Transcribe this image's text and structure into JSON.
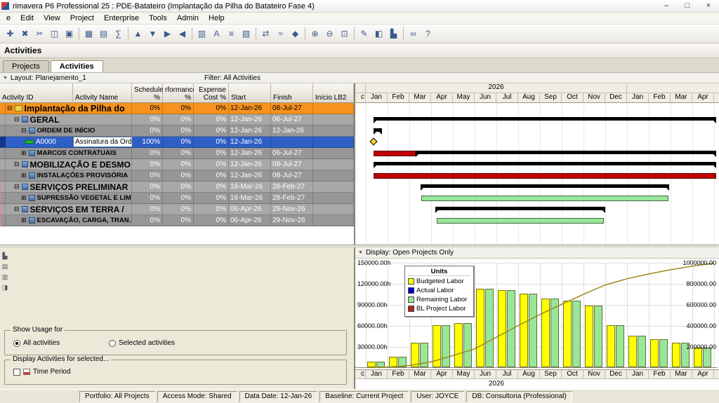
{
  "window": {
    "title": "rimavera P6 Professional 25 : PDE-Batateiro (Implantação da Pilha do Batateiro Fase 4)",
    "minimize": "–",
    "maximize": "□",
    "close": "×"
  },
  "menu": {
    "items": [
      "e",
      "Edit",
      "View",
      "Project",
      "Enterprise",
      "Tools",
      "Admin",
      "Help"
    ]
  },
  "toolbar": {
    "icons": [
      {
        "name": "add-row-icon",
        "glyph": "✚"
      },
      {
        "name": "delete-row-icon",
        "glyph": "✖"
      },
      {
        "name": "cut-icon",
        "glyph": "✂"
      },
      {
        "name": "copy-icon",
        "glyph": "◫"
      },
      {
        "name": "paste-icon",
        "glyph": "▣"
      },
      {
        "sep": true
      },
      {
        "name": "schedule-icon",
        "glyph": "▦"
      },
      {
        "name": "level-resources-icon",
        "glyph": "▤"
      },
      {
        "name": "summarize-icon",
        "glyph": "∑"
      },
      {
        "sep": true
      },
      {
        "name": "move-up-icon",
        "glyph": "▲"
      },
      {
        "name": "move-down-icon",
        "glyph": "▼"
      },
      {
        "name": "indent-icon",
        "glyph": "▶"
      },
      {
        "name": "outdent-icon",
        "glyph": "◀"
      },
      {
        "sep": true
      },
      {
        "name": "columns-icon",
        "glyph": "▥"
      },
      {
        "name": "table-font-icon",
        "glyph": "A"
      },
      {
        "name": "filters-icon",
        "glyph": "≡"
      },
      {
        "name": "group-sort-icon",
        "glyph": "▧"
      },
      {
        "sep": true
      },
      {
        "name": "relationships-icon",
        "glyph": "⇄"
      },
      {
        "name": "progress-line-icon",
        "glyph": "≈"
      },
      {
        "name": "data-date-icon",
        "glyph": "◆"
      },
      {
        "sep": true
      },
      {
        "name": "zoom-in-icon",
        "glyph": "⊕"
      },
      {
        "name": "zoom-out-icon",
        "glyph": "⊖"
      },
      {
        "name": "zoom-fit-icon",
        "glyph": "⊡"
      },
      {
        "sep": true
      },
      {
        "name": "assign-resources-icon",
        "glyph": "✎"
      },
      {
        "name": "activity-details-icon",
        "glyph": "◧"
      },
      {
        "name": "usage-profile-icon",
        "glyph": "▙"
      },
      {
        "sep": true
      },
      {
        "name": "link-icon",
        "glyph": "∞"
      },
      {
        "name": "help-icon",
        "glyph": "?"
      }
    ]
  },
  "view_title": "Activities",
  "tabs": {
    "projects": "Projects",
    "activities": "Activities"
  },
  "layout_bar": {
    "chevron": "▼",
    "layout": "Layout: Planejamento_1",
    "filter": "Filter: All Activities"
  },
  "table": {
    "headers": {
      "id": "Activity ID",
      "name": "Activity Name",
      "schedule": "Schedule\n%",
      "performance": "rformance\n%",
      "expense": "Expense\nCost %",
      "start": "Start",
      "finish": "Finish",
      "inicio": "Início LB2"
    },
    "rows": [
      {
        "expand": "⊟",
        "label": "Implantação da Pilha do",
        "schedule": "0%",
        "performance": "0%",
        "expense": "0%",
        "start": "12-Jan-26",
        "finish": "08-Jul-27",
        "inicio": ""
      },
      {
        "expand": "⊟",
        "label": "GERAL",
        "schedule": "0%",
        "performance": "0%",
        "expense": "0%",
        "start": "12-Jan-26",
        "finish": "06-Jul-27",
        "inicio": ""
      },
      {
        "expand": "⊟",
        "label": "ORDEM DE INÍCIO",
        "schedule": "0%",
        "performance": "0%",
        "expense": "0%",
        "start": "12-Jan-26",
        "finish": "12-Jan-26",
        "inicio": ""
      },
      {
        "id": "A0000",
        "name": "Assinatura da Orde",
        "schedule": "100%",
        "performance": "0%",
        "expense": "0%",
        "start": "12-Jan-26",
        "finish": "",
        "inicio": ""
      },
      {
        "expand": "⊞",
        "label": "MARCOS CONTRATUAIS",
        "schedule": "0%",
        "performance": "0%",
        "expense": "0%",
        "start": "12-Jan-26",
        "finish": "06-Jul-27",
        "inicio": ""
      },
      {
        "expand": "⊟",
        "label": "MOBILIZAÇÃO E DESMO",
        "schedule": "0%",
        "performance": "0%",
        "expense": "0%",
        "start": "12-Jan-26",
        "finish": "08-Jul-27",
        "inicio": ""
      },
      {
        "expand": "⊞",
        "label": "INSTALAÇÕES PROVISÓRIA",
        "schedule": "0%",
        "performance": "0%",
        "expense": "0%",
        "start": "12-Jan-26",
        "finish": "08-Jul-27",
        "inicio": ""
      },
      {
        "expand": "⊟",
        "label": "SERVIÇOS PRELIMINAR",
        "schedule": "0%",
        "performance": "0%",
        "expense": "0%",
        "start": "16-Mar-26",
        "finish": "28-Feb-27",
        "inicio": ""
      },
      {
        "expand": "⊞",
        "label": "SUPRESSÃO VEGETAL E LIM",
        "schedule": "0%",
        "performance": "0%",
        "expense": "0%",
        "start": "16-Mar-26",
        "finish": "28-Feb-27",
        "inicio": ""
      },
      {
        "expand": "⊟",
        "label": "SERVIÇOS EM TERRA /",
        "schedule": "0%",
        "performance": "0%",
        "expense": "0%",
        "start": "06-Apr-26",
        "finish": "29-Nov-26",
        "inicio": ""
      },
      {
        "expand": "⊞",
        "label": "ESCAVAÇÃO, CARGA, TRAN...",
        "schedule": "0%",
        "performance": "0%",
        "expense": "0%",
        "start": "06-Apr-26",
        "finish": "29-Nov-26",
        "inicio": ""
      }
    ]
  },
  "gantt": {
    "cut": "c",
    "year": "2026",
    "months": [
      "Jan",
      "Feb",
      "Mar",
      "Apr",
      "May",
      "Jun",
      "Jul",
      "Aug",
      "Sep",
      "Oct",
      "Nov",
      "Dec",
      "Jan",
      "Feb",
      "Mar",
      "Apr"
    ],
    "rows": [
      [],
      [
        {
          "type": "summary",
          "from": 0.35,
          "to": 16.1
        }
      ],
      [
        {
          "type": "summary",
          "from": 0.35,
          "to": 0.75
        }
      ],
      [
        {
          "type": "milestone",
          "at": 0.35,
          "color": "#F5D327"
        }
      ],
      [
        {
          "type": "bar",
          "from": 0.35,
          "to": 2.3,
          "color": "#C00000"
        },
        {
          "type": "summary",
          "from": 2.3,
          "to": 16.1
        }
      ],
      [
        {
          "type": "summary",
          "from": 0.35,
          "to": 16.1
        }
      ],
      [
        {
          "type": "bar",
          "from": 0.35,
          "to": 16.1,
          "color": "#C00000"
        }
      ],
      [
        {
          "type": "summary",
          "from": 2.5,
          "to": 13.95
        }
      ],
      [
        {
          "type": "bar",
          "from": 2.55,
          "to": 13.9,
          "color": "#98E698"
        }
      ],
      [
        {
          "type": "summary",
          "from": 3.2,
          "to": 11.0
        }
      ],
      [
        {
          "type": "bar",
          "from": 3.25,
          "to": 10.95,
          "color": "#98E698"
        }
      ]
    ]
  },
  "usage_panel": {
    "mini_icons": [
      {
        "name": "profile-settings-icon",
        "glyph": "▙"
      },
      {
        "name": "usage-table-icon",
        "glyph": "▤"
      },
      {
        "name": "histogram-view-icon",
        "glyph": "▥"
      },
      {
        "name": "panel-options-icon",
        "glyph": "◨"
      }
    ],
    "show_usage_for": "Show Usage for",
    "all_activities": "All activities",
    "selected_activities": "Selected activities",
    "display_activities": "Display Activities for selected...",
    "time_period": "Time Period"
  },
  "profile": {
    "chevron": "▼",
    "display": "Display: Open Projects Only",
    "legend_title": "Units",
    "legend": [
      {
        "label": "Budgeted Labor",
        "color": "#FFFF00"
      },
      {
        "label": "Actual Labor",
        "color": "#0000CC"
      },
      {
        "label": "Remaining Labor",
        "color": "#98E698"
      },
      {
        "label": "BL Project Labor",
        "color": "#B22222"
      }
    ],
    "left_axis": [
      "150000.00h",
      "120000.00h",
      "90000.00h",
      "60000.00h",
      "30000.00h"
    ],
    "right_axis": [
      "1000000.00",
      "800000.00",
      "600000.00",
      "400000.00",
      "200000.00"
    ],
    "cut": "c",
    "year": "2026"
  },
  "chart_data": {
    "type": "bar",
    "title": "Resource Usage Profile - Units",
    "categories": [
      "Jan-26",
      "Feb-26",
      "Mar-26",
      "Apr-26",
      "May-26",
      "Jun-26",
      "Jul-26",
      "Aug-26",
      "Sep-26",
      "Oct-26",
      "Nov-26",
      "Dec-26",
      "Jan-27",
      "Feb-27",
      "Mar-27",
      "Apr-27"
    ],
    "series": [
      {
        "name": "Budgeted Labor",
        "color": "#FFFF00",
        "values": [
          8000,
          15000,
          35000,
          60000,
          63000,
          112000,
          110000,
          105000,
          98000,
          95000,
          88000,
          60000,
          45000,
          40000,
          35000,
          28000
        ]
      },
      {
        "name": "Remaining Labor",
        "color": "#98E698",
        "values": [
          8000,
          15000,
          35000,
          60000,
          63000,
          112000,
          110000,
          105000,
          98000,
          95000,
          88000,
          60000,
          45000,
          40000,
          35000,
          28000
        ]
      },
      {
        "name": "Actual Labor",
        "color": "#0000CC",
        "values": [
          0,
          0,
          0,
          0,
          0,
          0,
          0,
          0,
          0,
          0,
          0,
          0,
          0,
          0,
          0,
          0
        ]
      }
    ],
    "cumulative_line": {
      "name": "BL Project Labor (cumulative)",
      "color": "#9C8A1C",
      "values": [
        8000,
        23000,
        58000,
        118000,
        181000,
        293000,
        403000,
        508000,
        606000,
        701000,
        789000,
        849000,
        894000,
        934000,
        969000,
        997000
      ]
    },
    "xlabel": "2026",
    "ylabel": "hours",
    "ylim_left": [
      0,
      150000
    ],
    "ylim_right": [
      0,
      1000000
    ],
    "legend_position": "top-left",
    "grid": true
  },
  "colors": {
    "wbs_band_orange": "#F6921E",
    "wbs_band_gray": "#A8A8A8",
    "wbs_band_gray_dark": "#979797",
    "selection_blue": "#2E5FC7",
    "summary_black": "#000000"
  },
  "statusbar": {
    "items": [
      "Portfolio: All Projects",
      "Access Mode: Shared",
      "Data Date: 12-Jan-26",
      "Baseline: Current Project",
      "User: JOYCE",
      "DB: Consultoria (Professional)"
    ]
  }
}
